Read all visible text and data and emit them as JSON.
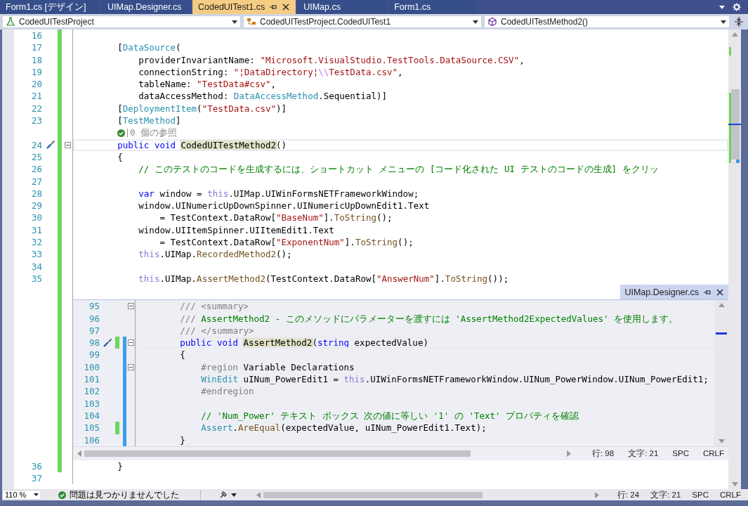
{
  "tabs": [
    {
      "label": "Form1.cs [デザイン]",
      "selected": false
    },
    {
      "label": "UIMap.Designer.cs",
      "selected": false
    },
    {
      "label": "CodedUITest1.cs",
      "selected": true
    },
    {
      "label": "UIMap.cs",
      "selected": false
    },
    {
      "label": "Form1.cs",
      "selected": false
    }
  ],
  "nav": {
    "project": "CodedUITestProject",
    "type": "CodedUITestProject.CodedUITest1",
    "member": "CodedUITestMethod2()"
  },
  "editor": {
    "lines": [
      {
        "kind": "code",
        "number": "16",
        "changed": true
      },
      {
        "kind": "code",
        "number": "17",
        "changed": true,
        "tokens": [
          {
            "kind": "plain",
            "text": "        ["
          },
          {
            "kind": "type",
            "text": "DataSource"
          },
          {
            "kind": "plain",
            "text": "("
          }
        ]
      },
      {
        "kind": "code",
        "number": "18",
        "changed": true,
        "tokens": [
          {
            "kind": "plain",
            "text": "            providerInvariantName: "
          },
          {
            "kind": "str",
            "text": "\"Microsoft.VisualStudio.TestTools.DataSource.CSV\""
          },
          {
            "kind": "plain",
            "text": ","
          }
        ]
      },
      {
        "kind": "code",
        "number": "19",
        "changed": true,
        "tokens": [
          {
            "kind": "plain",
            "text": "            connectionString: "
          },
          {
            "kind": "str",
            "text": "\"¦DataDirectory¦"
          },
          {
            "kind": "escape",
            "text": "\\\\"
          },
          {
            "kind": "str",
            "text": "TestData.csv\""
          },
          {
            "kind": "plain",
            "text": ","
          }
        ]
      },
      {
        "kind": "code",
        "number": "20",
        "changed": true,
        "tokens": [
          {
            "kind": "plain",
            "text": "            tableName: "
          },
          {
            "kind": "str",
            "text": "\"TestData#csv\""
          },
          {
            "kind": "plain",
            "text": ","
          }
        ]
      },
      {
        "kind": "code",
        "number": "21",
        "changed": true,
        "tokens": [
          {
            "kind": "plain",
            "text": "            dataAccessMethod: "
          },
          {
            "kind": "type",
            "text": "DataAccessMethod"
          },
          {
            "kind": "plain",
            "text": ".Sequential)]"
          }
        ]
      },
      {
        "kind": "code",
        "number": "22",
        "changed": true,
        "tokens": [
          {
            "kind": "plain",
            "text": "        ["
          },
          {
            "kind": "type",
            "text": "DeploymentItem"
          },
          {
            "kind": "plain",
            "text": "("
          },
          {
            "kind": "str",
            "text": "\"TestData.csv\""
          },
          {
            "kind": "plain",
            "text": ")]"
          }
        ]
      },
      {
        "kind": "code",
        "number": "23",
        "changed": true,
        "tokens": [
          {
            "kind": "plain",
            "text": "        ["
          },
          {
            "kind": "type",
            "text": "TestMethod"
          },
          {
            "kind": "plain",
            "text": "]"
          }
        ]
      },
      {
        "kind": "codelens",
        "changed": true,
        "text": "0 個の参照"
      },
      {
        "kind": "code",
        "number": "24",
        "changed": true,
        "current": true,
        "quick_action": true,
        "fold": true,
        "tokens": [
          {
            "kind": "kw",
            "text": "        public "
          },
          {
            "kind": "kw",
            "text": "void "
          },
          {
            "kind": "def",
            "text": "CodedUITestMethod2"
          },
          {
            "kind": "plain",
            "text": "()"
          }
        ]
      },
      {
        "kind": "code",
        "number": "25",
        "changed": true,
        "tokens": [
          {
            "kind": "plain",
            "text": "        {"
          }
        ]
      },
      {
        "kind": "code",
        "number": "26",
        "changed": true,
        "tokens": [
          {
            "kind": "comment",
            "text": "            // このテストのコードを生成するには、ショートカット メニューの [コード化された UI テストのコードの生成] をクリッ"
          }
        ]
      },
      {
        "kind": "code",
        "number": "27",
        "changed": true
      },
      {
        "kind": "code",
        "number": "28",
        "changed": true,
        "tokens": [
          {
            "kind": "kw",
            "text": "            var"
          },
          {
            "kind": "plain",
            "text": " window = "
          },
          {
            "kind": "this",
            "text": "this"
          },
          {
            "kind": "plain",
            "text": ".UIMap.UIWinFormsNETFrameworkWindow;"
          }
        ]
      },
      {
        "kind": "code",
        "number": "29",
        "changed": true,
        "tokens": [
          {
            "kind": "plain",
            "text": "            window.UINumericUpDownSpinner.UINumericUpDownEdit1.Text"
          }
        ]
      },
      {
        "kind": "code",
        "number": "30",
        "changed": true,
        "tokens": [
          {
            "kind": "plain",
            "text": "                = TestContext.DataRow["
          },
          {
            "kind": "str",
            "text": "\"BaseNum\""
          },
          {
            "kind": "plain",
            "text": "]."
          },
          {
            "kind": "method",
            "text": "ToString"
          },
          {
            "kind": "plain",
            "text": "();"
          }
        ]
      },
      {
        "kind": "code",
        "number": "31",
        "changed": true,
        "tokens": [
          {
            "kind": "plain",
            "text": "            window.UIItemSpinner.UIItemEdit1.Text"
          }
        ]
      },
      {
        "kind": "code",
        "number": "32",
        "changed": true,
        "tokens": [
          {
            "kind": "plain",
            "text": "                = TestContext.DataRow["
          },
          {
            "kind": "str",
            "text": "\"ExponentNum\""
          },
          {
            "kind": "plain",
            "text": "]."
          },
          {
            "kind": "method",
            "text": "ToString"
          },
          {
            "kind": "plain",
            "text": "();"
          }
        ]
      },
      {
        "kind": "code",
        "number": "33",
        "changed": true,
        "tokens": [
          {
            "kind": "this",
            "text": "            this"
          },
          {
            "kind": "plain",
            "text": ".UIMap."
          },
          {
            "kind": "method",
            "text": "RecordedMethod2"
          },
          {
            "kind": "plain",
            "text": "();"
          }
        ]
      },
      {
        "kind": "code",
        "number": "34",
        "changed": true
      },
      {
        "kind": "code",
        "number": "35",
        "changed": true,
        "tokens": [
          {
            "kind": "this",
            "text": "            this"
          },
          {
            "kind": "plain",
            "text": ".UIMap."
          },
          {
            "kind": "method",
            "text": "AssertMethod2"
          },
          {
            "kind": "plain",
            "text": "(TestContext.DataRow["
          },
          {
            "kind": "str",
            "text": "\"AnswerNum\""
          },
          {
            "kind": "plain",
            "text": "]."
          },
          {
            "kind": "method",
            "text": "ToString"
          },
          {
            "kind": "plain",
            "text": "());"
          }
        ]
      }
    ],
    "peek": {
      "title": "UIMap.Designer.cs",
      "lines": [
        {
          "number": "95",
          "changed": false,
          "in_range": false,
          "fold": true,
          "tokens": [
            {
              "kind": "doc",
              "text": "        /// <summary>"
            }
          ]
        },
        {
          "number": "96",
          "changed": false,
          "in_range": false,
          "tokens": [
            {
              "kind": "doc",
              "text": "        /// "
            },
            {
              "kind": "comment",
              "text": "AssertMethod2 - このメソッドにパラメーターを渡すには 'AssertMethod2ExpectedValues' を使用します。"
            }
          ]
        },
        {
          "number": "97",
          "changed": false,
          "in_range": false,
          "tokens": [
            {
              "kind": "doc",
              "text": "        /// </summary>"
            }
          ]
        },
        {
          "number": "98",
          "changed": true,
          "in_range": true,
          "fold": true,
          "current": true,
          "quick_action": true,
          "tokens": [
            {
              "kind": "kw",
              "text": "        public "
            },
            {
              "kind": "kw",
              "text": "void "
            },
            {
              "kind": "def",
              "text": "AssertMethod2"
            },
            {
              "kind": "plain",
              "text": "("
            },
            {
              "kind": "kw",
              "text": "string"
            },
            {
              "kind": "plain",
              "text": " expectedValue)"
            }
          ]
        },
        {
          "number": "99",
          "changed": false,
          "in_range": true,
          "tokens": [
            {
              "kind": "plain",
              "text": "        {"
            }
          ]
        },
        {
          "number": "100",
          "changed": false,
          "in_range": true,
          "fold": true,
          "tokens": [
            {
              "kind": "pre",
              "text": "            #region"
            },
            {
              "kind": "plain",
              "text": " Variable Declarations"
            }
          ]
        },
        {
          "number": "101",
          "changed": false,
          "in_range": true,
          "tokens": [
            {
              "kind": "type",
              "text": "            WinEdit"
            },
            {
              "kind": "plain",
              "text": " uINum_PowerEdit1 = "
            },
            {
              "kind": "this",
              "text": "this"
            },
            {
              "kind": "plain",
              "text": ".UIWinFormsNETFrameworkWindow.UINum_PowerWindow.UINum_PowerEdit1;"
            }
          ]
        },
        {
          "number": "102",
          "changed": false,
          "in_range": true,
          "tokens": [
            {
              "kind": "pre",
              "text": "            #endregion"
            }
          ]
        },
        {
          "number": "103",
          "changed": false,
          "in_range": true
        },
        {
          "number": "104",
          "changed": false,
          "in_range": true,
          "tokens": [
            {
              "kind": "comment",
              "text": "            // 'Num_Power' テキスト ボックス 次の値に等しい '1' の 'Text' プロパティを確認"
            }
          ]
        },
        {
          "number": "105",
          "changed": true,
          "in_range": true,
          "tokens": [
            {
              "kind": "type",
              "text": "            Assert"
            },
            {
              "kind": "plain",
              "text": "."
            },
            {
              "kind": "method",
              "text": "AreEqual"
            },
            {
              "kind": "plain",
              "text": "(expectedValue, uINum_PowerEdit1.Text);"
            }
          ]
        },
        {
          "number": "106",
          "changed": false,
          "in_range": true,
          "tokens": [
            {
              "kind": "plain",
              "text": "        }"
            }
          ]
        }
      ],
      "status": {
        "line": "行: 98",
        "column": "文字: 21",
        "indent": "SPC",
        "eol": "CRLF"
      }
    },
    "lines_after": [
      {
        "kind": "code",
        "number": "36",
        "changed": true,
        "tokens": [
          {
            "kind": "plain",
            "text": "        }"
          }
        ]
      },
      {
        "kind": "code",
        "number": "37",
        "changed": false
      }
    ]
  },
  "status_bar": {
    "zoom": "110 %",
    "issues": "問題は見つかりませんでした",
    "line": "行: 24",
    "column": "文字: 21",
    "indent": "SPC",
    "eol": "CRLF"
  }
}
